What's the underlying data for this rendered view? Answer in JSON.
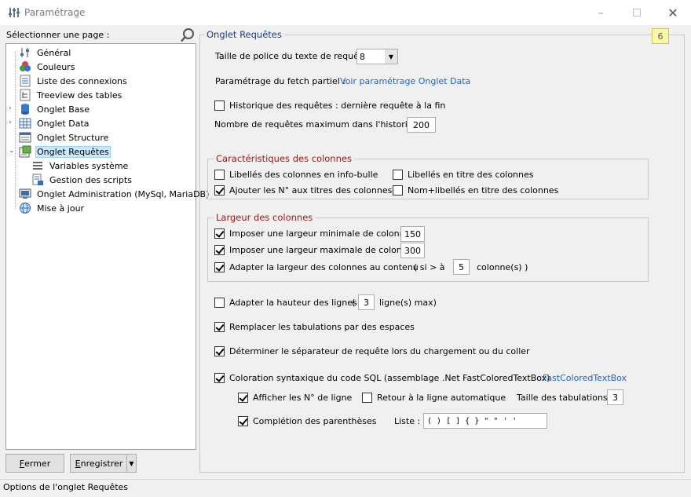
{
  "window": {
    "title": "Paramétrage",
    "minimize_icon": "minimize-icon",
    "maximize_icon": "maximize-icon",
    "close_icon": "close-icon"
  },
  "sidebar": {
    "label": "Sélectionner une page :",
    "items": [
      {
        "label": "Général",
        "icon": "sliders-icon"
      },
      {
        "label": "Couleurs",
        "icon": "palette-icon"
      },
      {
        "label": "Liste des connexions",
        "icon": "list-icon"
      },
      {
        "label": "Treeview des tables",
        "icon": "tree-icon"
      },
      {
        "label": "Onglet Base",
        "icon": "database-icon"
      },
      {
        "label": "Onglet Data",
        "icon": "grid-icon"
      },
      {
        "label": "Onglet Structure",
        "icon": "structure-icon"
      },
      {
        "label": "Onglet Requêtes",
        "icon": "query-icon"
      },
      {
        "label": "Variables système",
        "icon": "variables-icon"
      },
      {
        "label": "Gestion des scripts",
        "icon": "scripts-icon"
      },
      {
        "label": "Onglet Administration (MySql, MariaDB)",
        "icon": "admin-icon"
      },
      {
        "label": "Mise à jour",
        "icon": "globe-icon"
      }
    ]
  },
  "buttons": {
    "close": {
      "underline": "F",
      "rest": "ermer"
    },
    "save": {
      "underline": "E",
      "rest": "nregistrer"
    }
  },
  "status": "Options de l'onglet Requêtes",
  "main": {
    "title": "Onglet Requêtes",
    "badge": "6",
    "font_size_label": "Taille de police du texte de requête",
    "font_size_value": "8",
    "fetch_label": "Paramétrage du fetch partiel :",
    "fetch_link": "Voir paramétrage Onglet Data",
    "history_label": "Historique des requêtes : dernière requête à la fin",
    "history_max_label": "Nombre de requêtes maximum dans l'historique :",
    "history_max_value": "200",
    "columns_group": {
      "title": "Caractéristiques des colonnes",
      "infobulle": "Libellés des colonnes en info-bulle",
      "titre": "Libellés en titre des colonnes",
      "numero": "Ajouter les N° aux titres des colonnes",
      "nom_libelle": "Nom+libellés en titre des colonnes"
    },
    "width_group": {
      "title": "Largeur des colonnes",
      "min_label": "Imposer une largeur minimale de colonne :",
      "min_value": "150",
      "max_label": "Imposer une largeur maximale de colonne :",
      "max_value": "300",
      "adapt_label": "Adapter la largeur des colonnes au contenu",
      "si_label": "( si > à",
      "si_value": "5",
      "colonnes_label": "colonne(s) )"
    },
    "height_label": "Adapter la hauteur des lignes",
    "height_open": "(",
    "height_value": "3",
    "height_suffix": "ligne(s) max)",
    "tabs_label": "Remplacer les tabulations par des espaces",
    "separator_label": "Déterminer le séparateur de requête lors du chargement ou du coller",
    "syntax_label": "Coloration syntaxique du code SQL (assemblage .Net FastColoredTextBox)",
    "syntax_link": "FastColoredTextBox",
    "line_numbers_label": "Afficher les N° de ligne",
    "wrap_label": "Retour à la ligne automatique",
    "tab_size_label": "Taille des tabulations :",
    "tab_size_value": "3",
    "paren_label": "Complétion des parenthèses",
    "list_label": "Liste :",
    "list_value": "( ) [ ] { } \" \" ' '"
  }
}
